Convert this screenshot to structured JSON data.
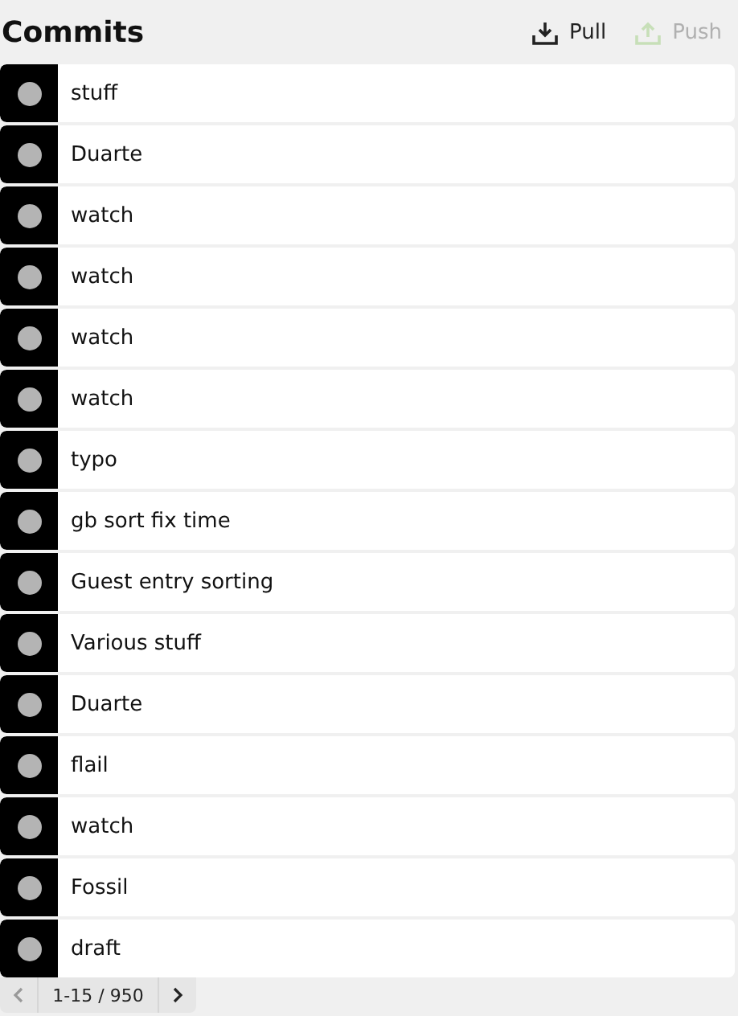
{
  "header": {
    "title": "Commits",
    "actions": [
      {
        "kind": "pull",
        "label": "Pull",
        "disabled": false
      },
      {
        "kind": "push",
        "label": "Push",
        "disabled": true
      }
    ]
  },
  "commits": [
    {
      "message": "stuff"
    },
    {
      "message": "Duarte"
    },
    {
      "message": "watch"
    },
    {
      "message": "watch"
    },
    {
      "message": "watch"
    },
    {
      "message": "watch"
    },
    {
      "message": "typo"
    },
    {
      "message": "gb sort fix time"
    },
    {
      "message": "Guest entry sorting"
    },
    {
      "message": "Various stuff"
    },
    {
      "message": "Duarte"
    },
    {
      "message": "flail"
    },
    {
      "message": "watch"
    },
    {
      "message": "Fossil"
    },
    {
      "message": "draft"
    }
  ],
  "pager": {
    "range": "1-15 / 950",
    "prev_disabled": true,
    "next_disabled": false
  }
}
